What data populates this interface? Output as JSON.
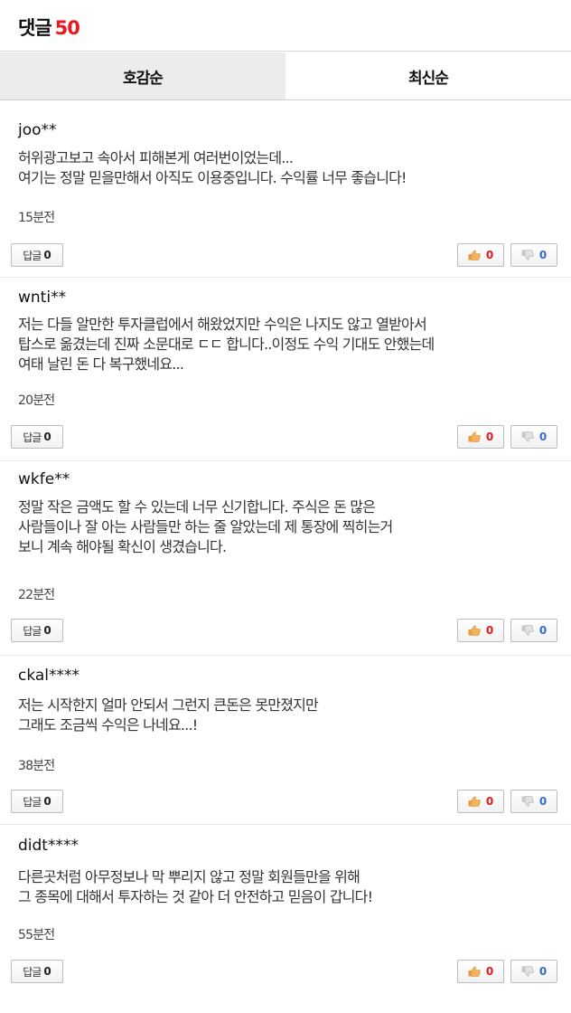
{
  "header": {
    "title": "댓글",
    "count": "50"
  },
  "tabs": {
    "popular": "호감순",
    "latest": "최신순"
  },
  "buttons": {
    "reply_label": "답글"
  },
  "colors": {
    "count": "#e8181e",
    "like": "#e8181e",
    "dislike": "#3a6bc9",
    "active_tab": "#ececec"
  },
  "icons": {
    "like": "thumbs-up-icon",
    "dislike": "thumbs-down-icon"
  },
  "comments": [
    {
      "user": "joo**",
      "lines": [
        "허위광고보고 속아서 피해본게 여러번이었는데...",
        "여기는 정말 믿을만해서 아직도 이용중입니다. 수익률 너무 좋습니다!"
      ],
      "time": "15분전",
      "replies": "0",
      "likes": "0",
      "dislikes": "0"
    },
    {
      "user": "wnti**",
      "lines": [
        "저는 다들 알만한 투자클럽에서 해왔었지만 수익은 나지도 않고 열받아서",
        "탑스로 옮겼는데 진짜 소문대로 ㄷㄷ 합니다..이정도 수익 기대도 안했는데",
        "여태 날린 돈 다 복구했네요..."
      ],
      "time": "20분전",
      "replies": "0",
      "likes": "0",
      "dislikes": "0"
    },
    {
      "user": "wkfe**",
      "lines": [
        "정말 작은 금액도 할 수 있는데 너무 신기합니다. 주식은 돈 많은",
        "사람들이나 잘 아는 사람들만 하는 줄 알았는데 제 통장에 찍히는거",
        "보니 계속 해야될 확신이 생겼습니다."
      ],
      "time": "22분전",
      "replies": "0",
      "likes": "0",
      "dislikes": "0"
    },
    {
      "user": "ckal****",
      "lines": [
        "저는 시작한지 얼마 안되서 그런지 큰돈은 못만졌지만",
        "그래도 조금씩 수익은 나네요...!"
      ],
      "time": "38분전",
      "replies": "0",
      "likes": "0",
      "dislikes": "0"
    },
    {
      "user": "didt****",
      "lines": [
        "다른곳처럼 아무정보나 막 뿌리지 않고 정말 회원들만을 위해",
        "그 종목에 대해서 투자하는 것 같아 더 안전하고 믿음이 갑니다!"
      ],
      "time": "55분전",
      "replies": "0",
      "likes": "0",
      "dislikes": "0"
    }
  ]
}
